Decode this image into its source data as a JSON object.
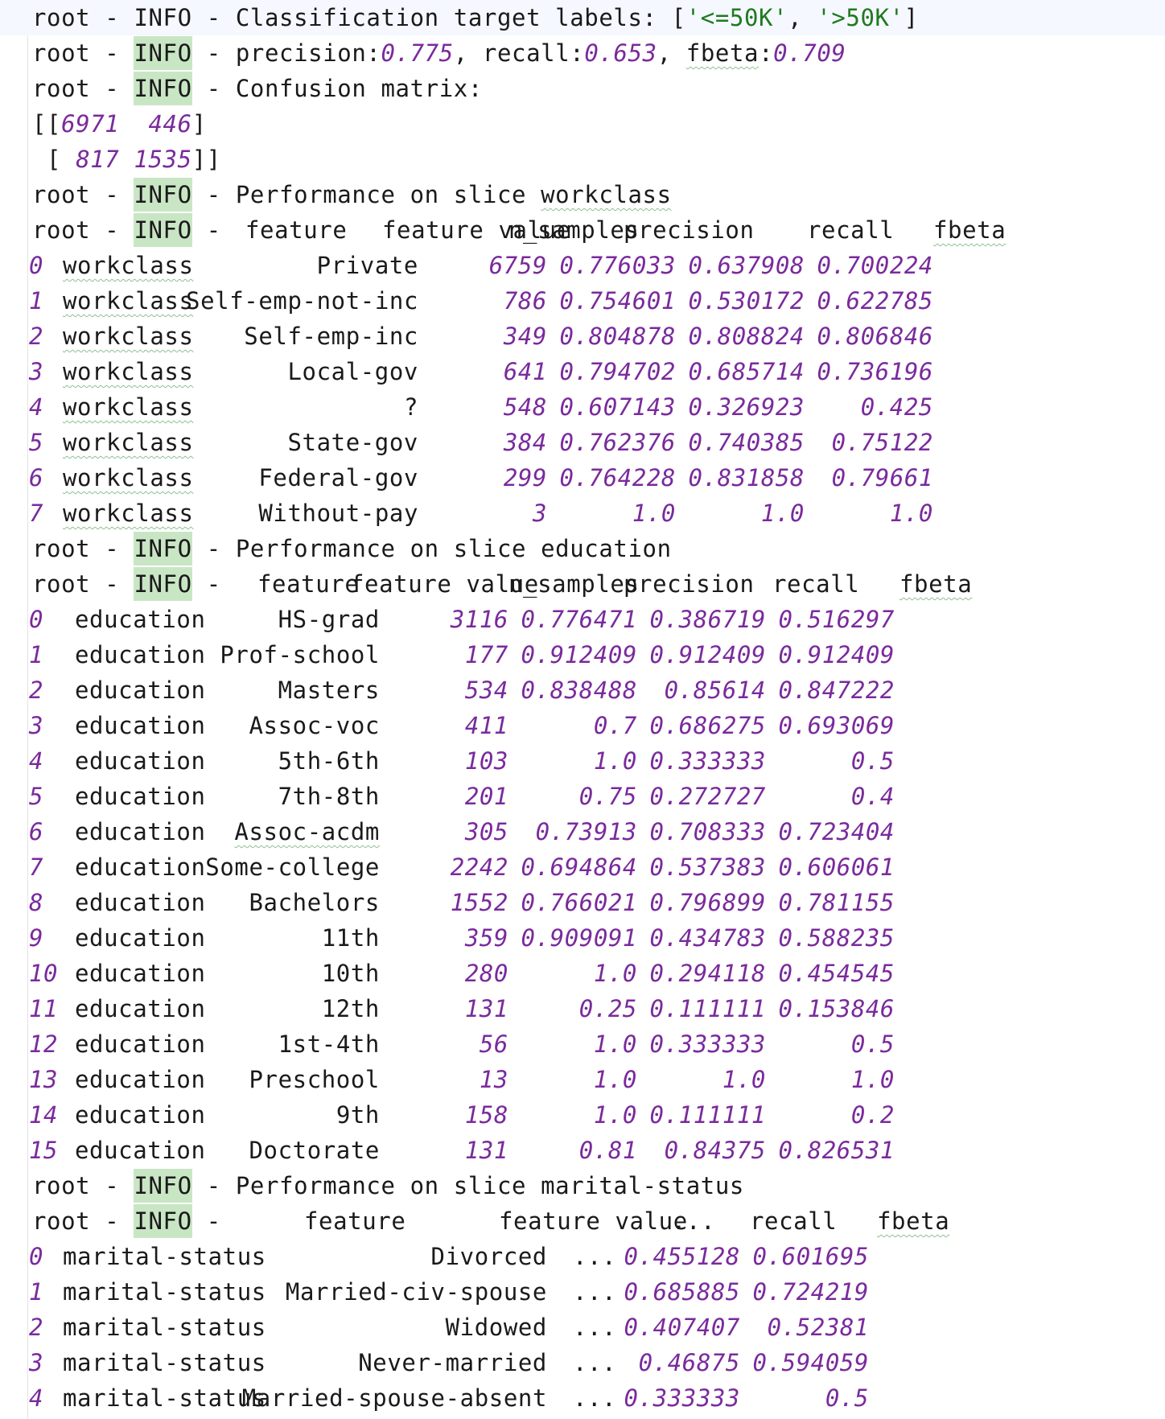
{
  "log": {
    "prefix": "root",
    "sep": " - ",
    "level": "INFO",
    "labels_text": "Classification target labels: [",
    "label_a": "'<=50K'",
    "label_sep": ", ",
    "label_b": "'>50K'",
    "labels_end": "]",
    "metrics_prefix": "precision:",
    "precision": "0.775",
    "recall_key": ", recall:",
    "recall": "0.653",
    "fbeta_sep": ", ",
    "fbeta_key": "fbeta",
    "fbeta_colon": ":",
    "fbeta": "0.709",
    "confusion_text": "Confusion matrix:",
    "cm_row1_open": "[[",
    "cm_row1_a": "6971",
    "cm_row1_gap": "  ",
    "cm_row1_b": "446",
    "cm_row1_close": "]",
    "cm_row2_open": " [ ",
    "cm_row2_a": "817",
    "cm_row2_gap": " ",
    "cm_row2_b": "1535",
    "cm_row2_close": "]]"
  },
  "slices": [
    {
      "title_text": "Performance on slice ",
      "title_feature": "workclass",
      "header_cols": [
        "feature",
        "feature value",
        "n_samples",
        "precision",
        "recall",
        "fbeta"
      ],
      "rows": [
        {
          "idx": "0",
          "feature": "workclass",
          "value": "Private",
          "n_samples": "6759",
          "precision": "0.776033",
          "recall": "0.637908",
          "fbeta": "0.700224"
        },
        {
          "idx": "1",
          "feature": "workclass",
          "value": "Self-emp-not-inc",
          "n_samples": "786",
          "precision": "0.754601",
          "recall": "0.530172",
          "fbeta": "0.622785"
        },
        {
          "idx": "2",
          "feature": "workclass",
          "value": "Self-emp-inc",
          "n_samples": "349",
          "precision": "0.804878",
          "recall": "0.808824",
          "fbeta": "0.806846"
        },
        {
          "idx": "3",
          "feature": "workclass",
          "value": "Local-gov",
          "n_samples": "641",
          "precision": "0.794702",
          "recall": "0.685714",
          "fbeta": "0.736196"
        },
        {
          "idx": "4",
          "feature": "workclass",
          "value": "?",
          "n_samples": "548",
          "precision": "0.607143",
          "recall": "0.326923",
          "fbeta": "0.425"
        },
        {
          "idx": "5",
          "feature": "workclass",
          "value": "State-gov",
          "n_samples": "384",
          "precision": "0.762376",
          "recall": "0.740385",
          "fbeta": "0.75122"
        },
        {
          "idx": "6",
          "feature": "workclass",
          "value": "Federal-gov",
          "n_samples": "299",
          "precision": "0.764228",
          "recall": "0.831858",
          "fbeta": "0.79661"
        },
        {
          "idx": "7",
          "feature": "workclass",
          "value": "Without-pay",
          "n_samples": "3",
          "precision": "1.0",
          "recall": "1.0",
          "fbeta": "1.0"
        }
      ]
    },
    {
      "title_text": "Performance on slice ",
      "title_feature": "education",
      "header_cols": [
        "feature",
        "feature value",
        "n_samples",
        "precision",
        "recall",
        "fbeta"
      ],
      "rows": [
        {
          "idx": "0",
          "feature": "education",
          "value": "HS-grad",
          "n_samples": "3116",
          "precision": "0.776471",
          "recall": "0.386719",
          "fbeta": "0.516297"
        },
        {
          "idx": "1",
          "feature": "education",
          "value": "Prof-school",
          "n_samples": "177",
          "precision": "0.912409",
          "recall": "0.912409",
          "fbeta": "0.912409"
        },
        {
          "idx": "2",
          "feature": "education",
          "value": "Masters",
          "n_samples": "534",
          "precision": "0.838488",
          "recall": "0.85614",
          "fbeta": "0.847222"
        },
        {
          "idx": "3",
          "feature": "education",
          "value": "Assoc-voc",
          "n_samples": "411",
          "precision": "0.7",
          "recall": "0.686275",
          "fbeta": "0.693069"
        },
        {
          "idx": "4",
          "feature": "education",
          "value": "5th-6th",
          "n_samples": "103",
          "precision": "1.0",
          "recall": "0.333333",
          "fbeta": "0.5"
        },
        {
          "idx": "5",
          "feature": "education",
          "value": "7th-8th",
          "n_samples": "201",
          "precision": "0.75",
          "recall": "0.272727",
          "fbeta": "0.4"
        },
        {
          "idx": "6",
          "feature": "education",
          "value": "Assoc-acdm",
          "n_samples": "305",
          "precision": "0.73913",
          "recall": "0.708333",
          "fbeta": "0.723404"
        },
        {
          "idx": "7",
          "feature": "education",
          "value": "Some-college",
          "n_samples": "2242",
          "precision": "0.694864",
          "recall": "0.537383",
          "fbeta": "0.606061"
        },
        {
          "idx": "8",
          "feature": "education",
          "value": "Bachelors",
          "n_samples": "1552",
          "precision": "0.766021",
          "recall": "0.796899",
          "fbeta": "0.781155"
        },
        {
          "idx": "9",
          "feature": "education",
          "value": "11th",
          "n_samples": "359",
          "precision": "0.909091",
          "recall": "0.434783",
          "fbeta": "0.588235"
        },
        {
          "idx": "10",
          "feature": "education",
          "value": "10th",
          "n_samples": "280",
          "precision": "1.0",
          "recall": "0.294118",
          "fbeta": "0.454545"
        },
        {
          "idx": "11",
          "feature": "education",
          "value": "12th",
          "n_samples": "131",
          "precision": "0.25",
          "recall": "0.111111",
          "fbeta": "0.153846"
        },
        {
          "idx": "12",
          "feature": "education",
          "value": "1st-4th",
          "n_samples": "56",
          "precision": "1.0",
          "recall": "0.333333",
          "fbeta": "0.5"
        },
        {
          "idx": "13",
          "feature": "education",
          "value": "Preschool",
          "n_samples": "13",
          "precision": "1.0",
          "recall": "1.0",
          "fbeta": "1.0"
        },
        {
          "idx": "14",
          "feature": "education",
          "value": "9th",
          "n_samples": "158",
          "precision": "1.0",
          "recall": "0.111111",
          "fbeta": "0.2"
        },
        {
          "idx": "15",
          "feature": "education",
          "value": "Doctorate",
          "n_samples": "131",
          "precision": "0.81",
          "recall": "0.84375",
          "fbeta": "0.826531"
        }
      ]
    },
    {
      "title_text": "Performance on slice ",
      "title_feature": "marital-status",
      "header_cols": [
        "feature",
        "feature value",
        "...",
        "recall",
        "fbeta"
      ],
      "rows": [
        {
          "idx": "0",
          "feature": "marital-status",
          "value": "Divorced",
          "ellipsis": "...",
          "recall": "0.455128",
          "fbeta": "0.601695"
        },
        {
          "idx": "1",
          "feature": "marital-status",
          "value": "Married-civ-spouse",
          "ellipsis": "...",
          "recall": "0.685885",
          "fbeta": "0.724219"
        },
        {
          "idx": "2",
          "feature": "marital-status",
          "value": "Widowed",
          "ellipsis": "...",
          "recall": "0.407407",
          "fbeta": "0.52381"
        },
        {
          "idx": "3",
          "feature": "marital-status",
          "value": "Never-married",
          "ellipsis": "...",
          "recall": "0.46875",
          "fbeta": "0.594059"
        },
        {
          "idx": "4",
          "feature": "marital-status",
          "value": "Married-spouse-absent",
          "ellipsis": "...",
          "recall": "0.333333",
          "fbeta": "0.5"
        }
      ]
    }
  ]
}
